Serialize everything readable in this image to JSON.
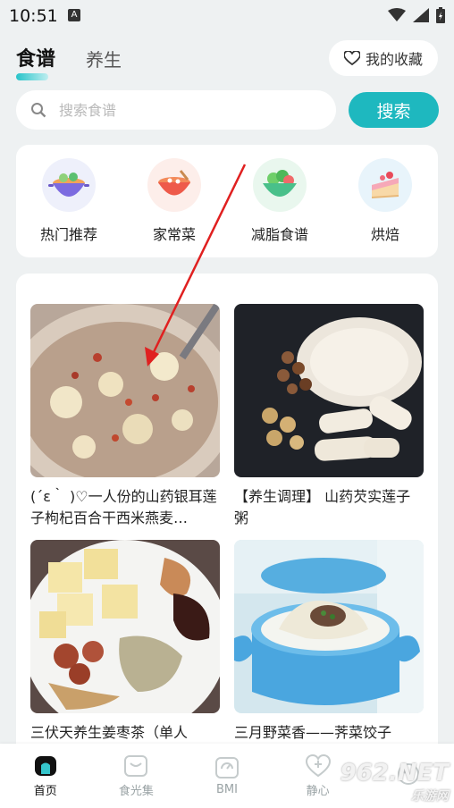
{
  "status": {
    "time": "10:51",
    "badge": "A"
  },
  "tabs": [
    {
      "label": "食谱"
    },
    {
      "label": "养生"
    }
  ],
  "favorites": {
    "label": "我的收藏"
  },
  "search": {
    "placeholder": "搜索食谱",
    "button": "搜索"
  },
  "categories": [
    {
      "label": "热门推荐",
      "icon": "pot-icon"
    },
    {
      "label": "家常菜",
      "icon": "soup-bowl-icon"
    },
    {
      "label": "减脂食谱",
      "icon": "salad-bowl-icon"
    },
    {
      "label": "烘焙",
      "icon": "cake-icon"
    }
  ],
  "recipes": [
    {
      "title": "(´ε｀ )♡一人份的山药银耳莲子枸杞百合干西米燕麦…"
    },
    {
      "title": "【养生调理】 山药芡实莲子粥"
    },
    {
      "title": "三伏天养生姜枣茶（单人"
    },
    {
      "title": "三月野菜香——荠菜饺子"
    }
  ],
  "bottom_nav": [
    {
      "label": "首页",
      "icon": "home-icon"
    },
    {
      "label": "食光集",
      "icon": "collection-icon"
    },
    {
      "label": "BMI",
      "icon": "scale-icon"
    },
    {
      "label": "静心",
      "icon": "heart-plus-icon"
    },
    {
      "label": "",
      "icon": "profile-icon"
    }
  ],
  "watermark": {
    "main": "962.NET",
    "sub": "乐游网"
  }
}
